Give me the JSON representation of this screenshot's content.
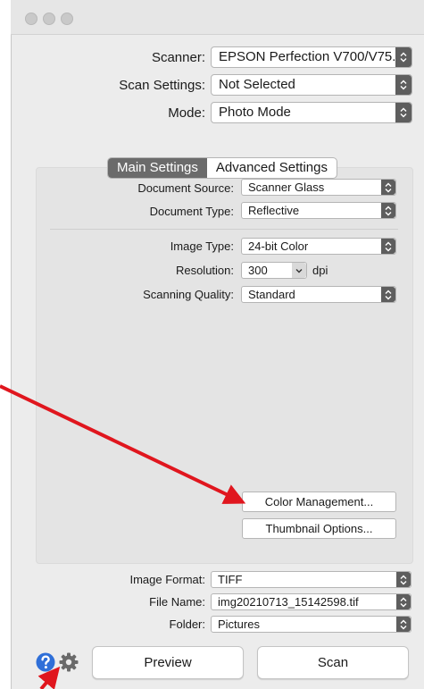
{
  "window": {
    "traffic_lights": [
      "close",
      "minimize",
      "zoom"
    ]
  },
  "top": {
    "scanner_label": "Scanner:",
    "scanner_value": "EPSON Perfection V700/V75...",
    "scan_settings_label": "Scan Settings:",
    "scan_settings_value": "Not Selected",
    "mode_label": "Mode:",
    "mode_value": "Photo Mode"
  },
  "tabs": {
    "main": "Main Settings",
    "advanced": "Advanced Settings",
    "active": "main"
  },
  "main": {
    "document_source_label": "Document Source:",
    "document_source_value": "Scanner Glass",
    "document_type_label": "Document Type:",
    "document_type_value": "Reflective",
    "image_type_label": "Image Type:",
    "image_type_value": "24-bit Color",
    "resolution_label": "Resolution:",
    "resolution_value": "300",
    "resolution_unit": "dpi",
    "scanning_quality_label": "Scanning Quality:",
    "scanning_quality_value": "Standard",
    "color_management_button": "Color Management...",
    "thumbnail_options_button": "Thumbnail Options..."
  },
  "bottom": {
    "image_format_label": "Image Format:",
    "image_format_value": "TIFF",
    "file_name_label": "File Name:",
    "file_name_value": "img20210713_15142598.tif",
    "folder_label": "Folder:",
    "folder_value": "Pictures",
    "preview_button": "Preview",
    "scan_button": "Scan"
  },
  "icons": {
    "help": "question-circle-icon",
    "settings": "gear-icon"
  },
  "colors": {
    "annotation_arrow": "#e0161e",
    "help_icon": "#2f6fd8",
    "tab_active": "#6b6b6b"
  }
}
